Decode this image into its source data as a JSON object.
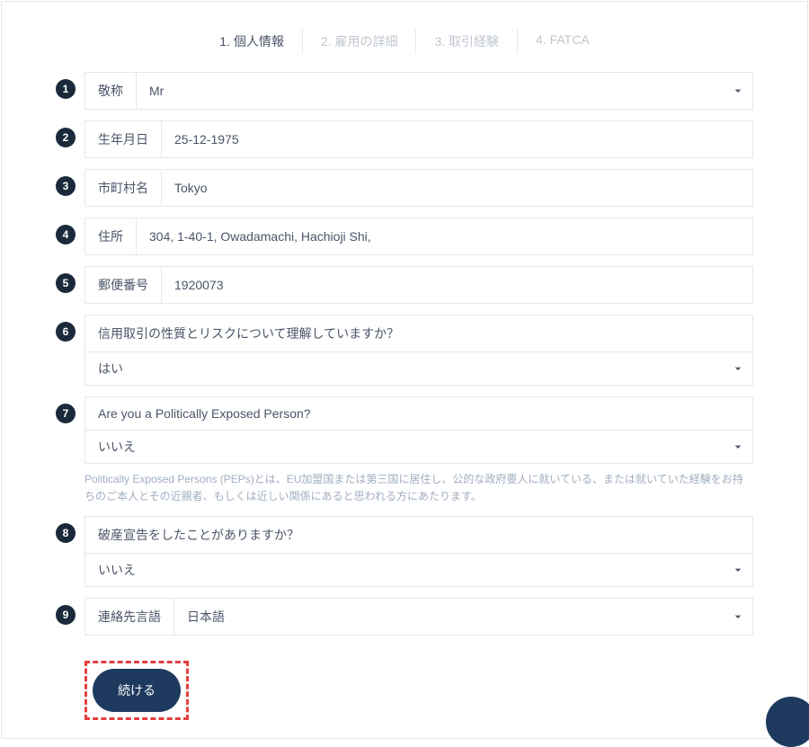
{
  "tabs": [
    {
      "label": "1. 個人情報",
      "active": true
    },
    {
      "label": "2. 雇用の詳細",
      "active": false
    },
    {
      "label": "3. 取引経験",
      "active": false
    },
    {
      "label": "4. FATCA",
      "active": false
    }
  ],
  "fields": {
    "title": {
      "step": "1",
      "label": "敬称",
      "value": "Mr"
    },
    "dob": {
      "step": "2",
      "label": "生年月日",
      "value": "25-12-1975"
    },
    "city": {
      "step": "3",
      "label": "市町村名",
      "value": "Tokyo"
    },
    "address": {
      "step": "4",
      "label": "住所",
      "value": "304, 1-40-1, Owadamachi, Hachioji Shi,"
    },
    "postal": {
      "step": "5",
      "label": "郵便番号",
      "value": "1920073"
    },
    "margin": {
      "step": "6",
      "label": "信用取引の性質とリスクについて理解していますか？",
      "value": "はい"
    },
    "pep": {
      "step": "7",
      "label": "Are you a Politically Exposed Person?",
      "value": "いいえ",
      "helper": "Politically Exposed Persons (PEPs)とは、EU加盟国または第三国に居住し、公的な政府要人に就いている、または就いていた経験をお持ちのご本人とその近親者、もしくは近しい関係にあると思われる方にあたります。"
    },
    "bankruptcy": {
      "step": "8",
      "label": "破産宣告をしたことがありますか？",
      "value": "いいえ"
    },
    "language": {
      "step": "9",
      "label": "連絡先言語",
      "value": "日本語"
    }
  },
  "submit": {
    "label": "続ける"
  }
}
